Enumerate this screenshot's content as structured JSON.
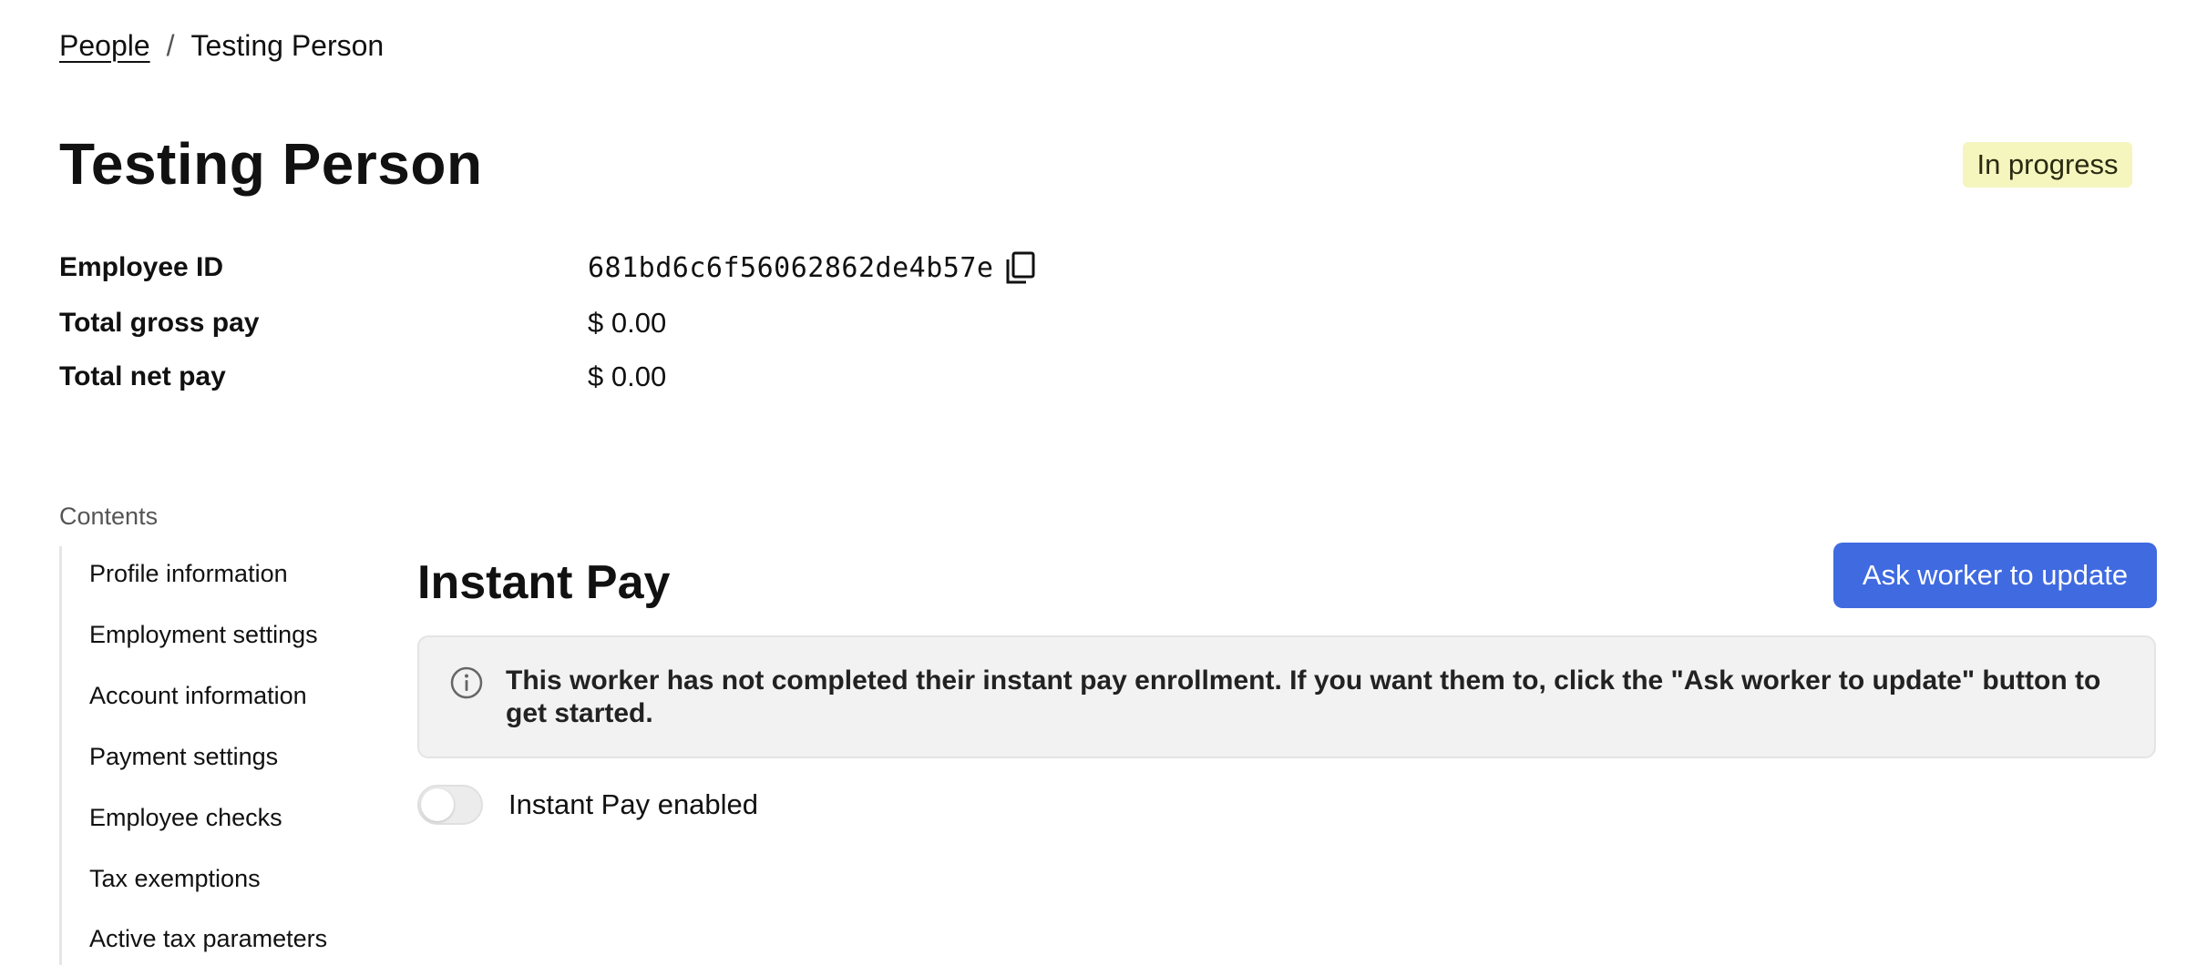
{
  "breadcrumb": {
    "parent": "People",
    "separator": "/",
    "current": "Testing Person"
  },
  "header": {
    "title": "Testing Person",
    "status": "In progress",
    "status_color": "#f4f6be"
  },
  "summary": {
    "employee_id": {
      "label": "Employee ID",
      "value": "681bd6c6f56062862de4b57e"
    },
    "gross_pay": {
      "label": "Total gross pay",
      "value": "$ 0.00"
    },
    "net_pay": {
      "label": "Total net pay",
      "value": "$ 0.00"
    }
  },
  "contents": {
    "heading": "Contents",
    "items": [
      {
        "label": "Profile information"
      },
      {
        "label": "Employment settings"
      },
      {
        "label": "Account information"
      },
      {
        "label": "Payment settings"
      },
      {
        "label": "Employee checks"
      },
      {
        "label": "Tax exemptions"
      },
      {
        "label": "Active tax parameters"
      }
    ]
  },
  "instant_pay": {
    "title": "Instant Pay",
    "button_label": "Ask worker to update",
    "button_color": "#3f6ae0",
    "notice": "This worker has not completed their instant pay enrollment. If you want them to, click the \"Ask worker to update\" button to get started.",
    "toggle_label": "Instant Pay enabled",
    "toggle_on": false
  },
  "icons": {
    "copy": "copy-icon",
    "info": "info-icon"
  }
}
